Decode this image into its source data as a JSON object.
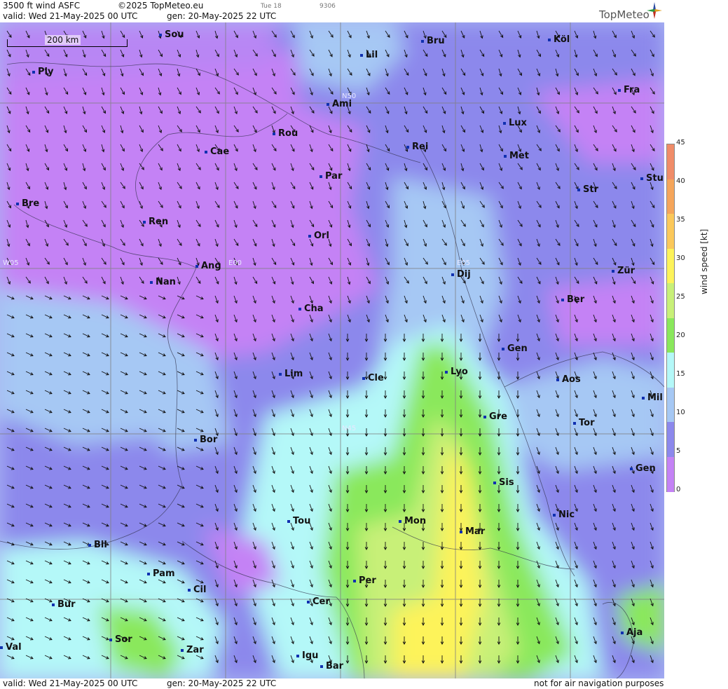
{
  "header": {
    "product": "3500 ft wind ASFC",
    "copyright": "©2025 TopMeteo.eu",
    "tab_day": "Tue 18",
    "code": "9306",
    "valid": "valid:  Wed  21-May-2025  00 UTC",
    "gen": "gen: 20-May-2025 22 UTC",
    "brand": "TopMeteo"
  },
  "footer": {
    "valid": "valid:  Wed  21-May-2025  00 UTC",
    "gen": "gen: 20-May-2025 22 UTC",
    "disclaimer": "not for air navigation purposes"
  },
  "map": {
    "scale_label": "200 km",
    "grid_labels": [
      "N50",
      "W05",
      "E00",
      "E05",
      "N45"
    ],
    "cities": [
      "Sou",
      "Ply",
      "Lil",
      "Bru",
      "Köl",
      "Ami",
      "Fra",
      "Lux",
      "Rou",
      "Cae",
      "Rei",
      "Met",
      "Par",
      "Stu",
      "Str",
      "Bre",
      "Ren",
      "Orl",
      "Ang",
      "Nan",
      "Dij",
      "Zür",
      "Ber",
      "Cha",
      "Gen",
      "Lim",
      "Cle",
      "Lyo",
      "Aos",
      "Mil",
      "Gre",
      "Tor",
      "Bor",
      "Gen",
      "Sis",
      "Nic",
      "Tou",
      "Mon",
      "Mar",
      "Bil",
      "Pam",
      "Cil",
      "Per",
      "Bur",
      "Cer",
      "Sor",
      "Aja",
      "Val",
      "Zar",
      "Igu",
      "Bar"
    ]
  },
  "legend": {
    "title": "wind speed [kt]",
    "ticks": [
      "45",
      "40",
      "35",
      "30",
      "25",
      "20",
      "15",
      "10",
      "5",
      "0"
    ],
    "colors": [
      "#f08c68",
      "#f5a55a",
      "#fbc85a",
      "#fdf35a",
      "#c8f078",
      "#8ae85c",
      "#b4f8f8",
      "#a6c8f4",
      "#8c88ec",
      "#c482f5"
    ]
  }
}
